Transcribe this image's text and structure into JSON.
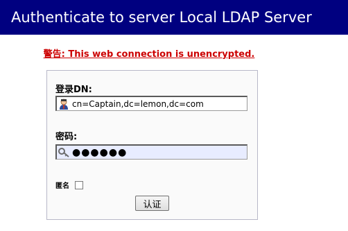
{
  "header": {
    "title": "Authenticate to server Local LDAP Server"
  },
  "warning": {
    "text": "警告: This web connection is unencrypted."
  },
  "form": {
    "dn_label": "登录DN:",
    "dn_value": "cn=Captain,dc=lemon,dc=com",
    "dn_icon": "user-icon",
    "password_label": "密码:",
    "password_value": "●●●●●●",
    "password_icon": "key-icon",
    "anonymous_label": "匿名",
    "anonymous_checked": false,
    "submit_label": "认证"
  },
  "colors": {
    "title_bar": "#000080",
    "warning": "#cc0000",
    "password_bg": "#e8ecff"
  }
}
